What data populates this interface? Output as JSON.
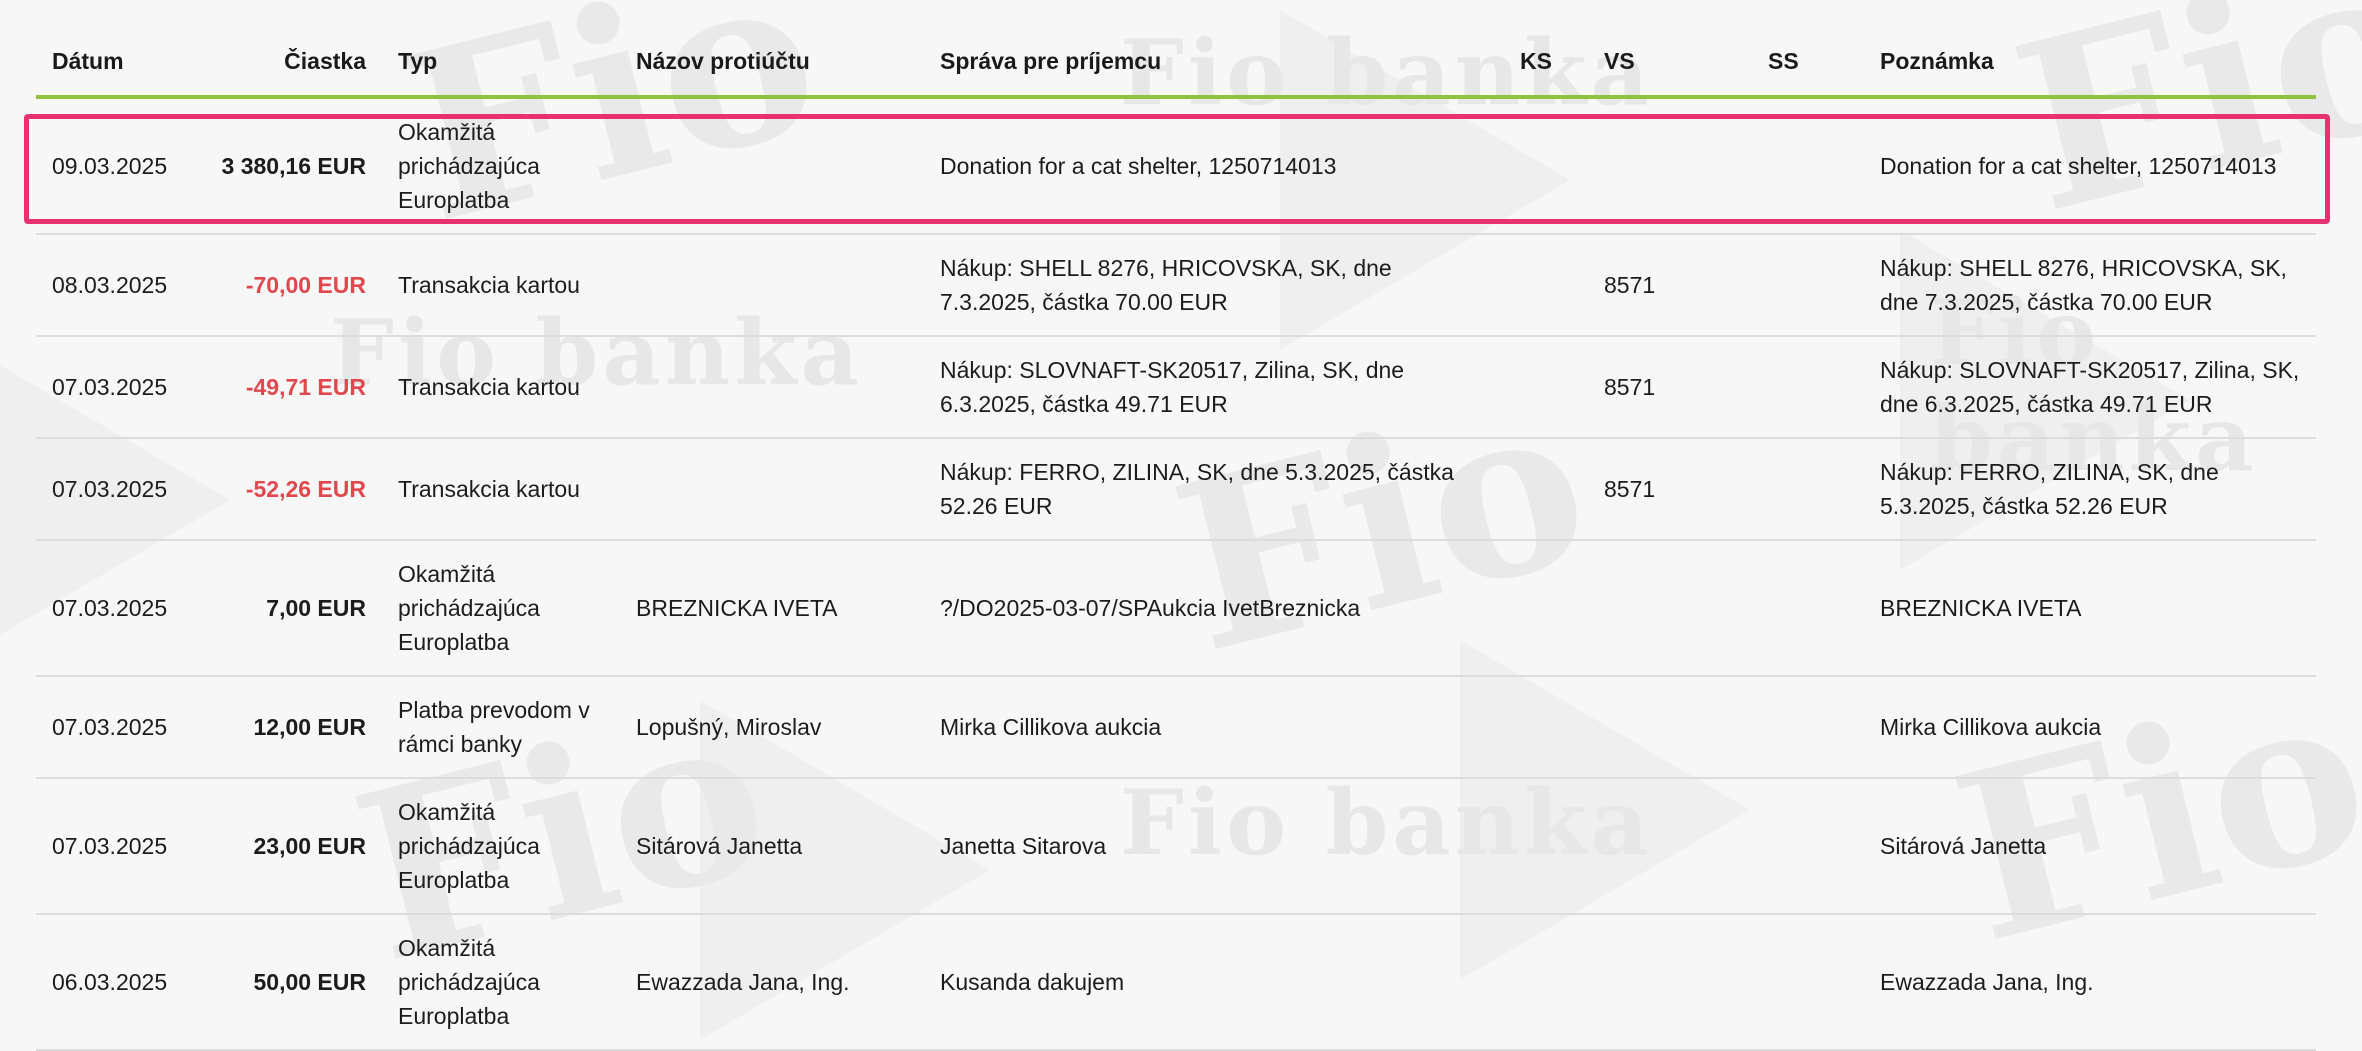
{
  "headers": {
    "date": "Dátum",
    "amount": "Čiastka",
    "type": "Typ",
    "counterparty": "Názov protiúčtu",
    "message": "Správa pre príjemcu",
    "ks": "KS",
    "vs": "VS",
    "ss": "SS",
    "note": "Poznámka"
  },
  "watermark": {
    "text": "Fio banka",
    "logo": "Fio"
  },
  "colors": {
    "accent_line": "#8fc241",
    "negative": "#e0484e",
    "highlight": "#e6336e"
  },
  "rows": [
    {
      "date": "09.03.2025",
      "amount": "3 380,16 EUR",
      "negative": false,
      "type": "Okamžitá prichádzajúca Europlatba",
      "counterparty": "",
      "message": "Donation for a cat shelter, 1250714013",
      "ks": "",
      "vs": "",
      "ss": "",
      "note": "Donation for a cat shelter, 1250714013"
    },
    {
      "date": "08.03.2025",
      "amount": "-70,00 EUR",
      "negative": true,
      "type": "Transakcia kartou",
      "counterparty": "",
      "message": "Nákup: SHELL 8276, HRICOVSKA, SK, dne 7.3.2025, částka 70.00 EUR",
      "ks": "",
      "vs": "8571",
      "ss": "",
      "note": "Nákup: SHELL 8276, HRICOVSKA, SK, dne 7.3.2025, částka 70.00 EUR"
    },
    {
      "date": "07.03.2025",
      "amount": "-49,71 EUR",
      "negative": true,
      "type": "Transakcia kartou",
      "counterparty": "",
      "message": "Nákup: SLOVNAFT-SK20517, Zilina, SK, dne 6.3.2025, částka 49.71 EUR",
      "ks": "",
      "vs": "8571",
      "ss": "",
      "note": "Nákup: SLOVNAFT-SK20517, Zilina, SK, dne 6.3.2025, částka 49.71 EUR"
    },
    {
      "date": "07.03.2025",
      "amount": "-52,26 EUR",
      "negative": true,
      "type": "Transakcia kartou",
      "counterparty": "",
      "message": "Nákup: FERRO, ZILINA, SK, dne 5.3.2025, částka 52.26 EUR",
      "ks": "",
      "vs": "8571",
      "ss": "",
      "note": "Nákup: FERRO, ZILINA, SK, dne 5.3.2025, částka 52.26 EUR"
    },
    {
      "date": "07.03.2025",
      "amount": "7,00 EUR",
      "negative": false,
      "type": "Okamžitá prichádzajúca Europlatba",
      "counterparty": "BREZNICKA IVETA",
      "message": "?/DO2025-03-07/SPAukcia IvetBreznicka",
      "ks": "",
      "vs": "",
      "ss": "",
      "note": "BREZNICKA IVETA"
    },
    {
      "date": "07.03.2025",
      "amount": "12,00 EUR",
      "negative": false,
      "type": "Platba prevodom v rámci banky",
      "counterparty": "Lopušný, Miroslav",
      "message": "Mirka Cillikova aukcia",
      "ks": "",
      "vs": "",
      "ss": "",
      "note": "Mirka Cillikova aukcia"
    },
    {
      "date": "07.03.2025",
      "amount": "23,00 EUR",
      "negative": false,
      "type": "Okamžitá prichádzajúca Europlatba",
      "counterparty": "Sitárová Janetta",
      "message": "Janetta Sitarova",
      "ks": "",
      "vs": "",
      "ss": "",
      "note": "Sitárová Janetta"
    },
    {
      "date": "06.03.2025",
      "amount": "50,00 EUR",
      "negative": false,
      "type": "Okamžitá prichádzajúca Europlatba",
      "counterparty": "Ewazzada Jana, Ing.",
      "message": "Kusanda dakujem",
      "ks": "",
      "vs": "",
      "ss": "",
      "note": "Ewazzada Jana, Ing."
    }
  ]
}
